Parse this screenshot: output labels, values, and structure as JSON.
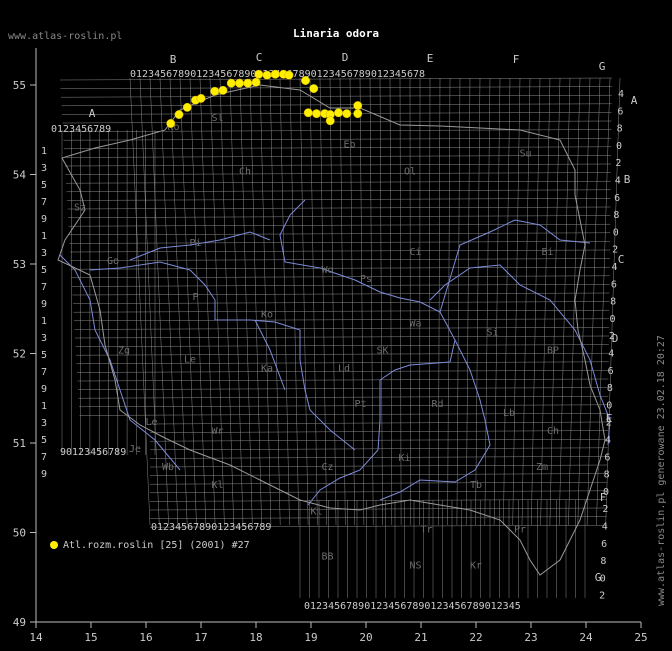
{
  "header": {
    "title": "Linaria odora",
    "site": "www.atlas-roslin.pl",
    "vertical_note": "www.atlas-roslin.pl generowane 23.02.18 20:27"
  },
  "axes": {
    "lon_ticks": [
      "14",
      "15",
      "16",
      "17",
      "18",
      "19",
      "20",
      "21",
      "22",
      "23",
      "24",
      "25"
    ],
    "lat_ticks": [
      "49",
      "50",
      "51",
      "52",
      "53",
      "54",
      "55"
    ],
    "lon_range": [
      14,
      25
    ],
    "lat_range": [
      49,
      55.5
    ]
  },
  "grid": {
    "column_letters": [
      "A",
      "B",
      "C",
      "D",
      "E",
      "F",
      "G"
    ],
    "row_letters": [
      "A",
      "B",
      "C",
      "D",
      "E",
      "F",
      "G"
    ],
    "top_row_digits": "0123456789012345678901234567890123456789012345678",
    "top_row_digits_a": "0123456789",
    "bottom_row_digits": "012345678901234567890123456789012345",
    "bottom_row_digits_left": "01234567890123456789",
    "left_row_digits": [
      "1",
      "3",
      "5",
      "7",
      "9",
      "1",
      "3",
      "5",
      "7",
      "9",
      "1",
      "3",
      "5",
      "7",
      "9",
      "1",
      "3",
      "5",
      "7",
      "9"
    ],
    "left_row_digits_bottom": "90123456789",
    "right_row_digits": [
      "4",
      "6",
      "8",
      "0",
      "2",
      "4",
      "6",
      "8",
      "0",
      "2",
      "4",
      "6",
      "8",
      "0",
      "2",
      "4",
      "6",
      "8",
      "0",
      "2",
      "4",
      "6",
      "8",
      "0",
      "2",
      "4",
      "6",
      "8",
      "0",
      "2"
    ]
  },
  "region_codes": [
    {
      "code": "Ko",
      "lon": 16.5,
      "lat": 54.5
    },
    {
      "code": "Sl",
      "lon": 17.3,
      "lat": 54.6
    },
    {
      "code": "Eb",
      "lon": 19.7,
      "lat": 54.3
    },
    {
      "code": "Su",
      "lon": 22.9,
      "lat": 54.2
    },
    {
      "code": "Ch",
      "lon": 17.8,
      "lat": 54.0
    },
    {
      "code": "Ol",
      "lon": 20.8,
      "lat": 54.0
    },
    {
      "code": "Sz",
      "lon": 14.8,
      "lat": 53.6
    },
    {
      "code": "Pi",
      "lon": 16.9,
      "lat": 53.2
    },
    {
      "code": "Ci",
      "lon": 20.9,
      "lat": 53.1
    },
    {
      "code": "Bi",
      "lon": 23.3,
      "lat": 53.1
    },
    {
      "code": "Go",
      "lon": 15.4,
      "lat": 53.0
    },
    {
      "code": "Wo",
      "lon": 19.3,
      "lat": 52.9
    },
    {
      "code": "Ps",
      "lon": 20.0,
      "lat": 52.8
    },
    {
      "code": "P",
      "lon": 16.9,
      "lat": 52.6
    },
    {
      "code": "Ko",
      "lon": 18.2,
      "lat": 52.4
    },
    {
      "code": "Wa",
      "lon": 20.9,
      "lat": 52.3
    },
    {
      "code": "Si",
      "lon": 22.3,
      "lat": 52.2
    },
    {
      "code": "BP",
      "lon": 23.4,
      "lat": 52.0
    },
    {
      "code": "Zg",
      "lon": 15.6,
      "lat": 52.0
    },
    {
      "code": "Le",
      "lon": 16.8,
      "lat": 51.9
    },
    {
      "code": "SK",
      "lon": 20.3,
      "lat": 52.0
    },
    {
      "code": "Ld",
      "lon": 19.6,
      "lat": 51.8
    },
    {
      "code": "Ka",
      "lon": 18.2,
      "lat": 51.8
    },
    {
      "code": "Pt",
      "lon": 19.9,
      "lat": 51.4
    },
    {
      "code": "Rd",
      "lon": 21.3,
      "lat": 51.4
    },
    {
      "code": "Lb",
      "lon": 22.6,
      "lat": 51.3
    },
    {
      "code": "Le",
      "lon": 16.1,
      "lat": 51.2
    },
    {
      "code": "Wr",
      "lon": 17.3,
      "lat": 51.1
    },
    {
      "code": "Ch",
      "lon": 23.4,
      "lat": 51.1
    },
    {
      "code": "Je",
      "lon": 15.8,
      "lat": 50.9
    },
    {
      "code": "Ki",
      "lon": 20.7,
      "lat": 50.8
    },
    {
      "code": "Wb",
      "lon": 16.4,
      "lat": 50.7
    },
    {
      "code": "Cz",
      "lon": 19.3,
      "lat": 50.7
    },
    {
      "code": "Zm",
      "lon": 23.2,
      "lat": 50.7
    },
    {
      "code": "Kl",
      "lon": 17.3,
      "lat": 50.5
    },
    {
      "code": "Tb",
      "lon": 22.0,
      "lat": 50.5
    },
    {
      "code": "Kt",
      "lon": 19.1,
      "lat": 50.2
    },
    {
      "code": "Tr",
      "lon": 21.1,
      "lat": 50.0
    },
    {
      "code": "Pr",
      "lon": 22.8,
      "lat": 50.0
    },
    {
      "code": "BB",
      "lon": 19.3,
      "lat": 49.7
    },
    {
      "code": "NS",
      "lon": 20.9,
      "lat": 49.6
    },
    {
      "code": "Kr",
      "lon": 22.0,
      "lat": 49.6
    }
  ],
  "records": [
    {
      "lon": 16.45,
      "lat": 54.57
    },
    {
      "lon": 16.6,
      "lat": 54.67
    },
    {
      "lon": 16.75,
      "lat": 54.75
    },
    {
      "lon": 16.9,
      "lat": 54.83
    },
    {
      "lon": 17.0,
      "lat": 54.85
    },
    {
      "lon": 17.25,
      "lat": 54.93
    },
    {
      "lon": 17.4,
      "lat": 54.94
    },
    {
      "lon": 17.55,
      "lat": 55.02
    },
    {
      "lon": 17.7,
      "lat": 55.02
    },
    {
      "lon": 17.85,
      "lat": 55.02
    },
    {
      "lon": 18.0,
      "lat": 55.03
    },
    {
      "lon": 18.05,
      "lat": 55.12
    },
    {
      "lon": 18.2,
      "lat": 55.11
    },
    {
      "lon": 18.35,
      "lat": 55.12
    },
    {
      "lon": 18.5,
      "lat": 55.12
    },
    {
      "lon": 18.6,
      "lat": 55.11
    },
    {
      "lon": 18.9,
      "lat": 55.05
    },
    {
      "lon": 19.05,
      "lat": 54.96
    },
    {
      "lon": 18.95,
      "lat": 54.69
    },
    {
      "lon": 19.1,
      "lat": 54.68
    },
    {
      "lon": 19.25,
      "lat": 54.68
    },
    {
      "lon": 19.35,
      "lat": 54.67
    },
    {
      "lon": 19.35,
      "lat": 54.6
    },
    {
      "lon": 19.5,
      "lat": 54.69
    },
    {
      "lon": 19.65,
      "lat": 54.68
    },
    {
      "lon": 19.85,
      "lat": 54.68
    },
    {
      "lon": 19.85,
      "lat": 54.77
    }
  ],
  "legend": {
    "label": "Atl.rozm.roslin [25] (2001) #27",
    "color": "#ffee00"
  },
  "colors": {
    "background": "#000000",
    "grid": "#8a8a8a",
    "rivers": "#7d8bd8",
    "border": "#9a9a9a",
    "text": "#cccccc",
    "region_text": "#6e6e6e",
    "point": "#ffee00"
  }
}
